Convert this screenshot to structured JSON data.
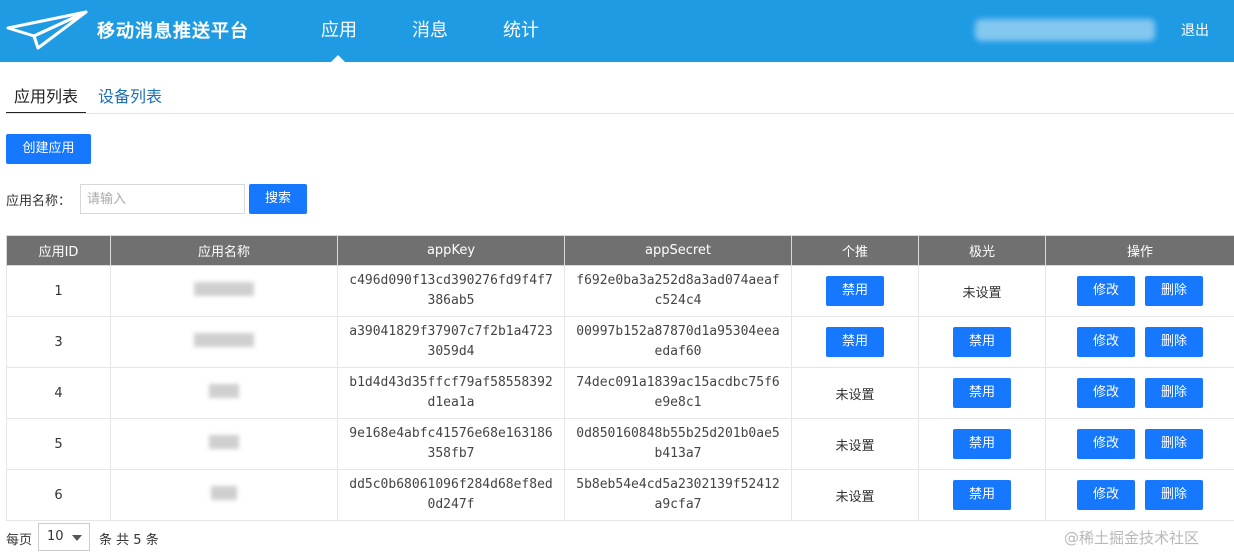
{
  "header": {
    "brand": "移动消息推送平台",
    "nav": [
      {
        "label": "应用",
        "active": true
      },
      {
        "label": "消息",
        "active": false
      },
      {
        "label": "统计",
        "active": false
      }
    ],
    "logout": "退出",
    "colors": {
      "header_bg": "#1f9be4",
      "accent": "#1677ff"
    }
  },
  "tabs": [
    {
      "label": "应用列表",
      "active": true
    },
    {
      "label": "设备列表",
      "active": false
    }
  ],
  "create_button": "创建应用",
  "search": {
    "label": "应用名称：",
    "placeholder": "请输入",
    "value": "",
    "button": "搜索"
  },
  "table": {
    "columns": [
      "应用ID",
      "应用名称",
      "appKey",
      "appSecret",
      "个推",
      "极光",
      "操作"
    ],
    "rows": [
      {
        "id": "1",
        "appKey": "c496d090f13cd390276fd9f4f7386ab5",
        "appSecret": "f692e0ba3a252d8a3ad074aeafc524c4",
        "getui": "禁用",
        "jiguang": "未设置"
      },
      {
        "id": "3",
        "appKey": "a39041829f37907c7f2b1a47233059d4",
        "appSecret": "00997b152a87870d1a95304eeaedaf60",
        "getui": "禁用",
        "jiguang": "禁用"
      },
      {
        "id": "4",
        "appKey": "b1d4d43d35ffcf79af58558392d1ea1a",
        "appSecret": "74dec091a1839ac15acdbc75f6e9e8c1",
        "getui": "未设置",
        "jiguang": "禁用"
      },
      {
        "id": "5",
        "appKey": "9e168e4abfc41576e68e163186358fb7",
        "appSecret": "0d850160848b55b25d201b0ae5b413a7",
        "getui": "未设置",
        "jiguang": "禁用"
      },
      {
        "id": "6",
        "appKey": "dd5c0b68061096f284d68ef8ed0d247f",
        "appSecret": "5b8eb54e4cd5a2302139f52412a9cfa7",
        "getui": "未设置",
        "jiguang": "禁用"
      }
    ],
    "actions": {
      "edit": "修改",
      "delete": "删除"
    }
  },
  "pagination": {
    "per_page_label": "每页",
    "page_size": "10",
    "total_prefix": "条 共",
    "total": "5",
    "total_suffix": "条"
  },
  "watermark": "@稀土掘金技术社区"
}
